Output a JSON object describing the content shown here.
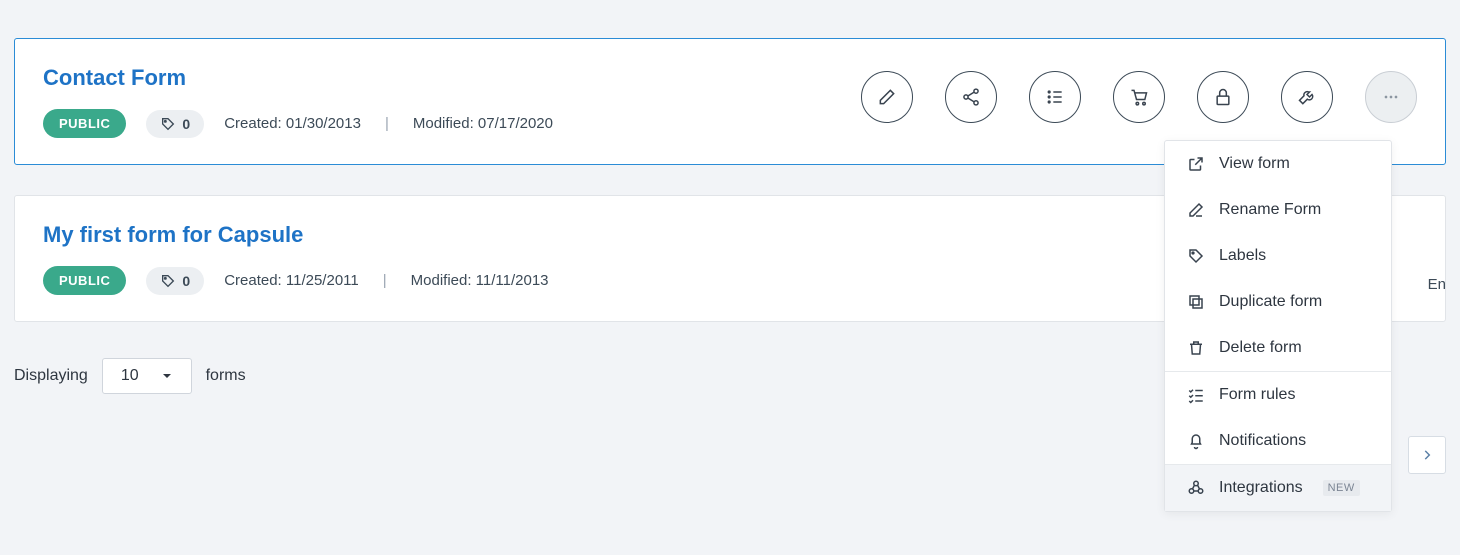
{
  "forms": [
    {
      "title": "Contact Form",
      "visibility": "PUBLIC",
      "tag_count": "0",
      "created_label": "Created: 01/30/2013",
      "modified_label": "Modified: 07/17/2020",
      "partial": ""
    },
    {
      "title": "My first form for Capsule",
      "visibility": "PUBLIC",
      "tag_count": "0",
      "created_label": "Created: 11/25/2011",
      "modified_label": "Modified: 11/11/2013",
      "partial": "En"
    }
  ],
  "pager": {
    "displaying": "Displaying",
    "value": "10",
    "forms": "forms"
  },
  "menu": {
    "view": "View form",
    "rename": "Rename Form",
    "labels": "Labels",
    "duplicate": "Duplicate form",
    "delete": "Delete form",
    "rules": "Form rules",
    "notifications": "Notifications",
    "integrations": "Integrations",
    "new": "NEW"
  }
}
